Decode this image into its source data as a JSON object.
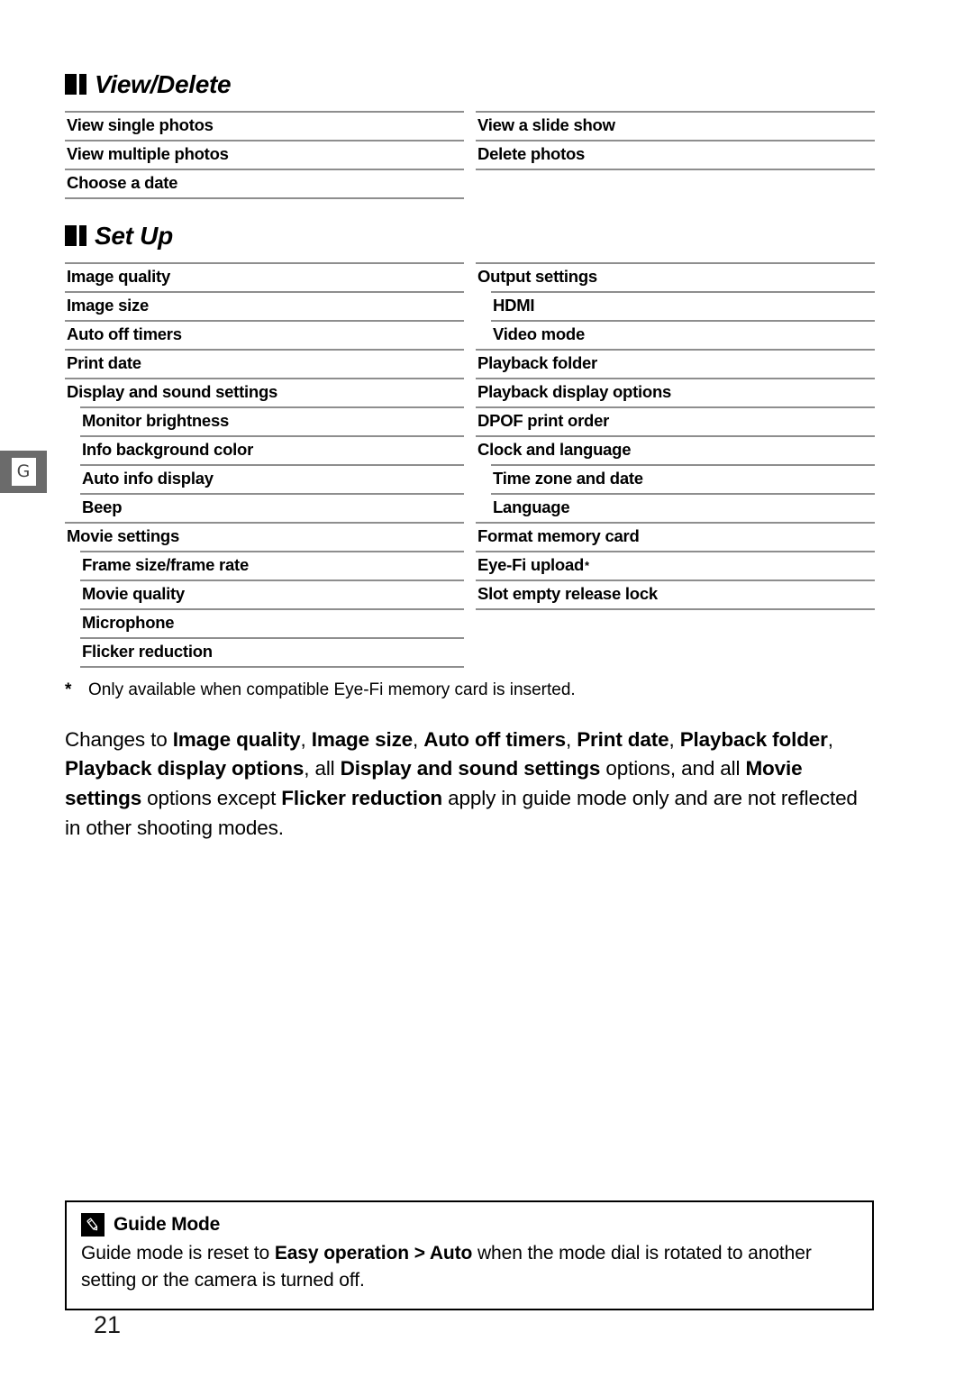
{
  "page": {
    "number": "21",
    "margin_tab_label": "G"
  },
  "sections": [
    {
      "id": "view-delete",
      "title": "View/Delete",
      "columns": [
        {
          "rows": [
            {
              "label": "View single photos",
              "level": 0
            },
            {
              "label": "View multiple photos",
              "level": 0
            },
            {
              "label": "Choose a date",
              "level": 0
            }
          ]
        },
        {
          "rows": [
            {
              "label": "View a slide show",
              "level": 0
            },
            {
              "label": "Delete photos",
              "level": 0
            }
          ]
        }
      ]
    },
    {
      "id": "set-up",
      "title": "Set Up",
      "columns": [
        {
          "rows": [
            {
              "label": "Image quality",
              "level": 0
            },
            {
              "label": "Image size",
              "level": 0
            },
            {
              "label": "Auto off timers",
              "level": 0
            },
            {
              "label": "Print date",
              "level": 0
            },
            {
              "label": "Display and sound settings",
              "level": 0
            },
            {
              "label": "Monitor brightness",
              "level": 1
            },
            {
              "label": "Info background color",
              "level": 1
            },
            {
              "label": "Auto info display",
              "level": 1
            },
            {
              "label": "Beep",
              "level": 1
            },
            {
              "label": "Movie settings",
              "level": 0
            },
            {
              "label": "Frame size/frame rate",
              "level": 1
            },
            {
              "label": "Movie quality",
              "level": 1
            },
            {
              "label": "Microphone",
              "level": 1
            },
            {
              "label": "Flicker reduction",
              "level": 1
            }
          ]
        },
        {
          "rows": [
            {
              "label": "Output settings",
              "level": 0
            },
            {
              "label": "HDMI",
              "level": 1
            },
            {
              "label": "Video mode",
              "level": 1
            },
            {
              "label": "Playback folder",
              "level": 0
            },
            {
              "label": "Playback display options",
              "level": 0
            },
            {
              "label": "DPOF print order",
              "level": 0
            },
            {
              "label": "Clock and language",
              "level": 0
            },
            {
              "label": "Time zone and date",
              "level": 1
            },
            {
              "label": "Language",
              "level": 1
            },
            {
              "label": "Format memory card",
              "level": 0
            },
            {
              "label": "Eye-Fi upload",
              "level": 0,
              "footnote_marker": "*"
            },
            {
              "label": "Slot empty release lock",
              "level": 0
            }
          ]
        }
      ]
    }
  ],
  "footnote": {
    "marker": "*",
    "text": "Only available when compatible Eye-Fi memory card is inserted."
  },
  "body_paragraph": {
    "parts": [
      {
        "text": "Changes to ",
        "bold": false
      },
      {
        "text": "Image quality",
        "bold": true
      },
      {
        "text": ", ",
        "bold": false
      },
      {
        "text": "Image size",
        "bold": true
      },
      {
        "text": ", ",
        "bold": false
      },
      {
        "text": "Auto off timers",
        "bold": true
      },
      {
        "text": ", ",
        "bold": false
      },
      {
        "text": "Print date",
        "bold": true
      },
      {
        "text": ", ",
        "bold": false
      },
      {
        "text": "Playback folder",
        "bold": true
      },
      {
        "text": ", ",
        "bold": false
      },
      {
        "text": "Playback display options",
        "bold": true
      },
      {
        "text": ", all ",
        "bold": false
      },
      {
        "text": "Display and sound settings",
        "bold": true
      },
      {
        "text": " options, and all ",
        "bold": false
      },
      {
        "text": "Movie settings",
        "bold": true
      },
      {
        "text": " options except ",
        "bold": false
      },
      {
        "text": "Flicker reduction",
        "bold": true
      },
      {
        "text": " apply in guide mode only and are not reflected in other shooting modes.",
        "bold": false
      }
    ]
  },
  "note_box": {
    "icon": "pencil-icon",
    "title": "Guide Mode",
    "body_parts": [
      {
        "text": "Guide mode is reset to ",
        "bold": false
      },
      {
        "text": "Easy operation > Auto",
        "bold": true
      },
      {
        "text": " when the mode dial is rotated to another setting or the camera is turned off.",
        "bold": false
      }
    ]
  }
}
